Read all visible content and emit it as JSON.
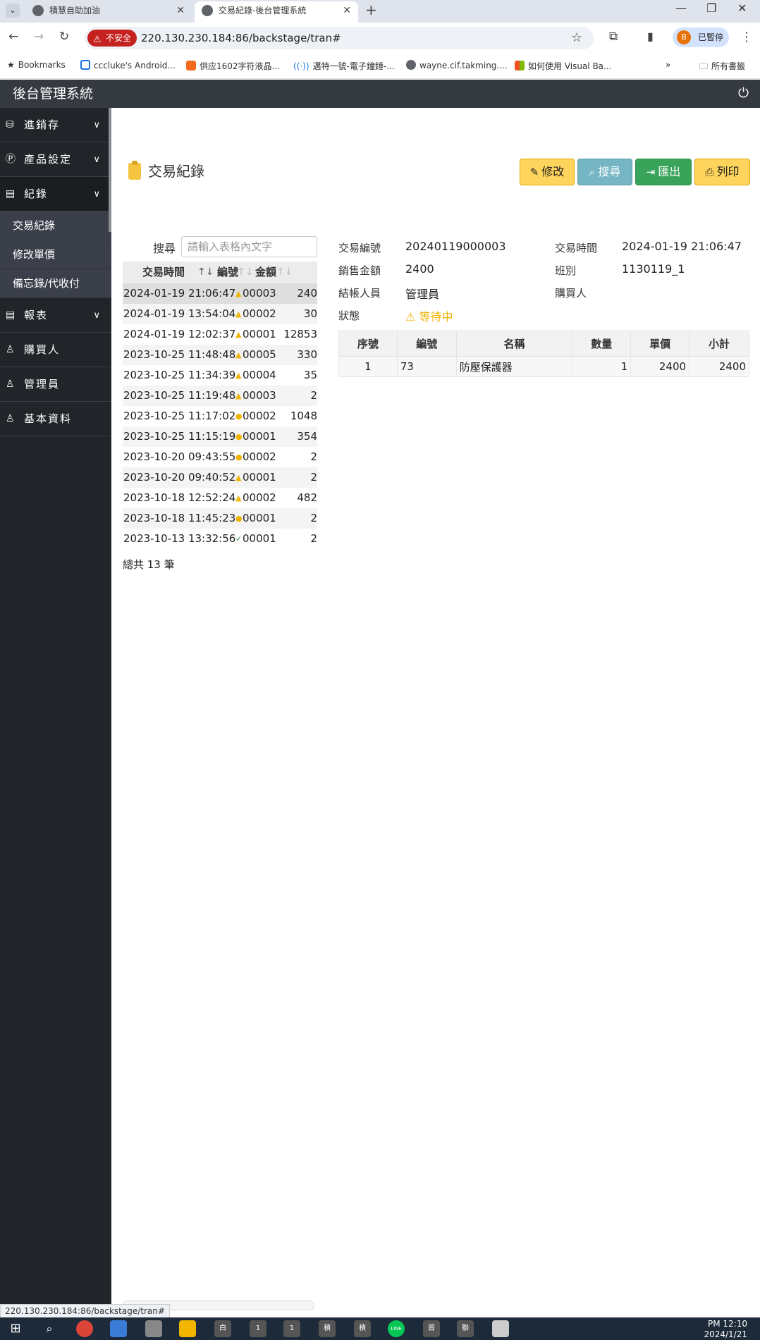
{
  "browser": {
    "tabs": [
      {
        "title": "積慧自助加油"
      },
      {
        "title": "交易紀錄-後台管理系統"
      }
    ],
    "insecure_label": "不安全",
    "url": "220.130.230.184:86/backstage/tran#",
    "profile_label": "已暫停",
    "profile_initial": "B",
    "bookmarks": [
      "Bookmarks",
      "cccluke's Android...",
      "供应1602字符液晶...",
      "邁特一號-電子鐘錘-...",
      "wayne.cif.takming....",
      "如何使用 Visual Ba...",
      "所有書籤"
    ],
    "status_url": "220.130.230.184:86/backstage/tran#"
  },
  "app": {
    "title": "後台管理系統"
  },
  "sidebar": {
    "items": [
      {
        "label": "進銷存"
      },
      {
        "label": "產品設定"
      },
      {
        "label": "紀錄"
      },
      {
        "label": "報表"
      },
      {
        "label": "購買人"
      },
      {
        "label": "管理員"
      },
      {
        "label": "基本資料"
      }
    ],
    "sub_items": [
      {
        "label": "交易紀錄"
      },
      {
        "label": "修改單價"
      },
      {
        "label": "備忘錄/代收付"
      }
    ]
  },
  "page": {
    "title": "交易紀錄",
    "buttons": {
      "edit": "修改",
      "search": "搜尋",
      "export": "匯出",
      "print": "列印"
    }
  },
  "list": {
    "search_label": "搜尋",
    "search_placeholder": "請輸入表格內文字",
    "columns": [
      "交易時間",
      "編號",
      "金額"
    ],
    "rows": [
      {
        "time": "2024-01-19 21:06:47",
        "no": "00003",
        "amount": "240"
      },
      {
        "time": "2024-01-19 13:54:04",
        "no": "00002",
        "amount": "30"
      },
      {
        "time": "2024-01-19 12:02:37",
        "no": "00001",
        "amount": "12853"
      },
      {
        "time": "2023-10-25 11:48:48",
        "no": "00005",
        "amount": "330"
      },
      {
        "time": "2023-10-25 11:34:39",
        "no": "00004",
        "amount": "35"
      },
      {
        "time": "2023-10-25 11:19:48",
        "no": "00003",
        "amount": "2"
      },
      {
        "time": "2023-10-25 11:17:02",
        "no": "00002",
        "amount": "1048"
      },
      {
        "time": "2023-10-25 11:15:19",
        "no": "00001",
        "amount": "354"
      },
      {
        "time": "2023-10-20 09:43:55",
        "no": "00002",
        "amount": "2"
      },
      {
        "time": "2023-10-20 09:40:52",
        "no": "00001",
        "amount": "2"
      },
      {
        "time": "2023-10-18 12:52:24",
        "no": "00002",
        "amount": "482"
      },
      {
        "time": "2023-10-18 11:45:23",
        "no": "00001",
        "amount": "2"
      },
      {
        "time": "2023-10-13 13:32:56",
        "no": "00001",
        "amount": "2"
      }
    ],
    "total_text": "總共 13 筆"
  },
  "detail": {
    "labels": {
      "tran_no": "交易編號",
      "tran_time": "交易時間",
      "sales_amount": "銷售金額",
      "shift": "班別",
      "cashier": "結帳人員",
      "buyer": "購買人",
      "status": "狀態"
    },
    "values": {
      "tran_no": "20240119000003",
      "tran_time": "2024-01-19 21:06:47",
      "sales_amount": "2400",
      "shift": "1130119_1",
      "cashier": "管理員",
      "buyer": "",
      "status": "等待中"
    },
    "table": {
      "columns": [
        "序號",
        "編號",
        "名稱",
        "數量",
        "單價",
        "小計"
      ],
      "rows": [
        [
          "1",
          "73",
          "防壓保護器",
          "1",
          "2400",
          "2400"
        ]
      ]
    }
  },
  "taskbar": {
    "clock_time": "PM 12:10",
    "clock_date": "2024/1/21",
    "app_labels": [
      "白",
      "1",
      "1",
      "積",
      "積",
      "LINE",
      "首",
      "聯"
    ]
  }
}
